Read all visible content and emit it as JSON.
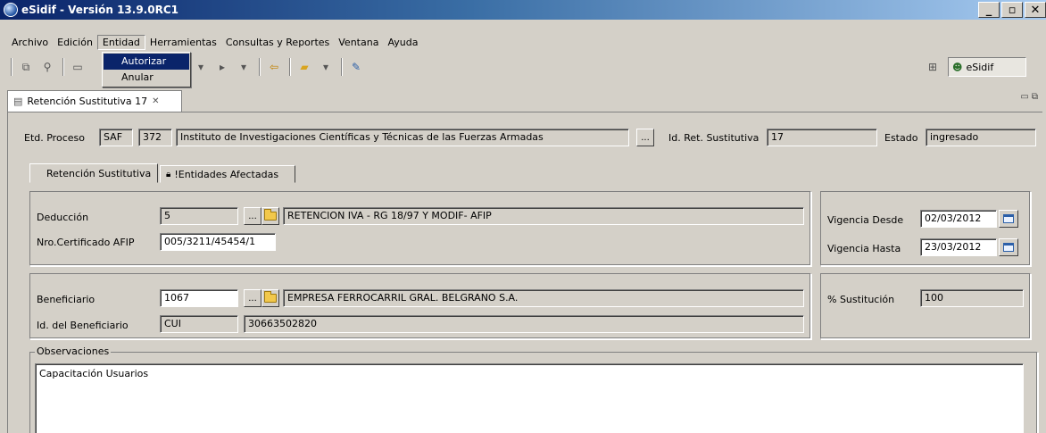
{
  "window": {
    "title": "eSidif - Versión 13.9.0RC1",
    "min_glyph": "_",
    "max_glyph": "▫",
    "close_glyph": "✕"
  },
  "menu": {
    "items": [
      {
        "label": "Archivo"
      },
      {
        "label": "Edición"
      },
      {
        "label": "Entidad"
      },
      {
        "label": "Herramientas"
      },
      {
        "label": "Consultas y Reportes"
      },
      {
        "label": "Ventana"
      },
      {
        "label": "Ayuda"
      }
    ],
    "open_menu": {
      "items": [
        "Autorizar",
        "Anular"
      ],
      "selected": "Autorizar"
    }
  },
  "perspective": {
    "label": "eSidif"
  },
  "editor_tab": {
    "label": "Retención Sustitutiva 17",
    "close_glyph": "✕"
  },
  "header": {
    "etd_proceso_label": "Etd. Proceso",
    "etd_code": "SAF",
    "etd_number": "372",
    "etd_name": "Instituto de Investigaciones Científicas y Técnicas de las Fuerzas Armadas",
    "ellipsis": "...",
    "id_ret_label": "Id. Ret. Sustitutiva",
    "id_ret_value": "17",
    "estado_label": "Estado",
    "estado_value": "ingresado"
  },
  "subtabs": [
    {
      "label": "Retención Sustitutiva"
    },
    {
      "label": "!Entidades Afectadas"
    }
  ],
  "deduccion": {
    "label": "Deducción",
    "code": "5",
    "description": "RETENCION IVA - RG 18/97 Y MODIF- AFIP",
    "cert_label": "Nro.Certificado AFIP",
    "cert_value": "005/3211/45454/1"
  },
  "vigencia": {
    "desde_label": "Vigencia Desde",
    "desde_value": "02/03/2012",
    "hasta_label": "Vigencia Hasta",
    "hasta_value": "23/03/2012"
  },
  "beneficiario": {
    "label": "Beneficiario",
    "code": "1067",
    "name": "EMPRESA FERROCARRIL GRAL. BELGRANO S.A.",
    "id_label": "Id. del Beneficiario",
    "id_type": "CUI",
    "id_value": "30663502820"
  },
  "sustitucion": {
    "label": "% Sustitución",
    "value": "100"
  },
  "observaciones": {
    "label": "Observaciones",
    "value": "Capacitación Usuarios"
  }
}
